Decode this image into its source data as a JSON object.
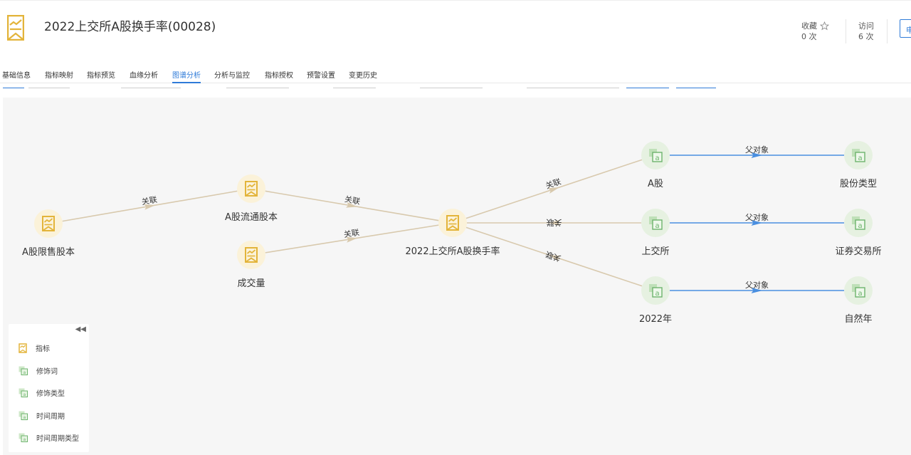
{
  "header": {
    "title": "2022上交所A股换手率(00028)",
    "favorite": {
      "label": "收藏",
      "count": "0 次"
    },
    "visits": {
      "label": "访问",
      "count": "6 次"
    },
    "apply_label": "申"
  },
  "tabs": [
    {
      "label": "基础信息",
      "active": false
    },
    {
      "label": "指标映射",
      "active": false
    },
    {
      "label": "指标预览",
      "active": false
    },
    {
      "label": "血缘分析",
      "active": false
    },
    {
      "label": "图谱分析",
      "active": true
    },
    {
      "label": "分析与监控",
      "active": false
    },
    {
      "label": "指标授权",
      "active": false
    },
    {
      "label": "预警设置",
      "active": false
    },
    {
      "label": "变更历史",
      "active": false
    }
  ],
  "graph": {
    "nodes": [
      {
        "id": "n1",
        "label": "A股限售股本",
        "type": "indicator"
      },
      {
        "id": "n2",
        "label": "A股流通股本",
        "type": "indicator"
      },
      {
        "id": "n3",
        "label": "成交量",
        "type": "indicator"
      },
      {
        "id": "n4",
        "label": "2022上交所A股换手率",
        "type": "indicator"
      },
      {
        "id": "n5",
        "label": "A股",
        "type": "modifier"
      },
      {
        "id": "n6",
        "label": "上交所",
        "type": "modifier"
      },
      {
        "id": "n7",
        "label": "2022年",
        "type": "modifier"
      },
      {
        "id": "n8",
        "label": "股份类型",
        "type": "modifier"
      },
      {
        "id": "n9",
        "label": "证券交易所",
        "type": "modifier"
      },
      {
        "id": "n10",
        "label": "自然年",
        "type": "modifier"
      }
    ],
    "edges": [
      {
        "from": "n1",
        "to": "n2",
        "label": "关联"
      },
      {
        "from": "n2",
        "to": "n4",
        "label": "关联"
      },
      {
        "from": "n3",
        "to": "n4",
        "label": "关联"
      },
      {
        "from": "n4",
        "to": "n5",
        "label": "关联"
      },
      {
        "from": "n6",
        "to": "n4",
        "label": "关联"
      },
      {
        "from": "n7",
        "to": "n4",
        "label": "关联"
      },
      {
        "from": "n5",
        "to": "n8",
        "label": "父对象"
      },
      {
        "from": "n6",
        "to": "n9",
        "label": "父对象"
      },
      {
        "from": "n7",
        "to": "n10",
        "label": "父对象"
      }
    ]
  },
  "legend": {
    "collapse_icon": "double-chevron-left-icon",
    "items": [
      {
        "label": "指标",
        "icon": "indicator-icon"
      },
      {
        "label": "修饰词",
        "icon": "modifier-icon"
      },
      {
        "label": "修饰类型",
        "icon": "modifier-icon"
      },
      {
        "label": "时间周期",
        "icon": "modifier-icon"
      },
      {
        "label": "时间周期类型",
        "icon": "modifier-icon"
      }
    ]
  },
  "colors": {
    "accent": "#2f7bd8",
    "indicator": "#e3b43a",
    "modifier": "#6db36d",
    "edge_relation": "#d8c9ad",
    "edge_parent": "#4a8fe0"
  }
}
